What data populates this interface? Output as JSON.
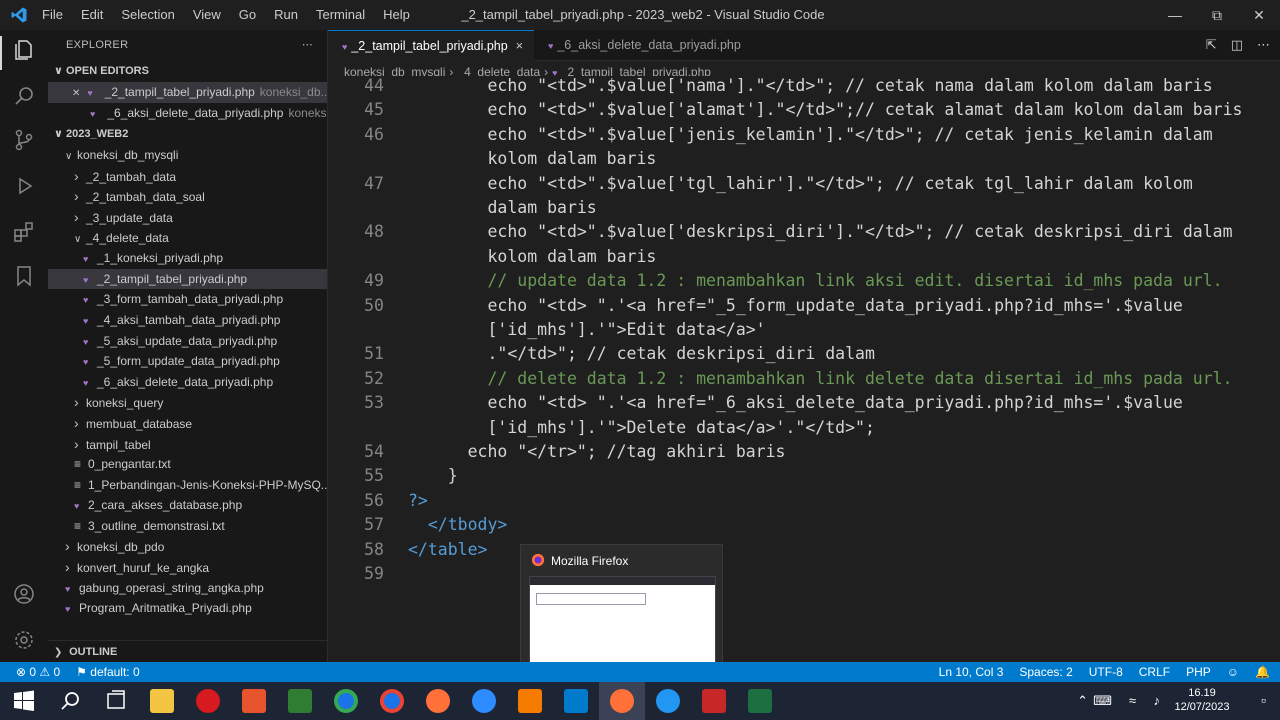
{
  "titlebar": {
    "menu": [
      "File",
      "Edit",
      "Selection",
      "View",
      "Go",
      "Run",
      "Terminal",
      "Help"
    ],
    "title": "_2_tampil_tabel_priyadi.php - 2023_web2 - Visual Studio Code"
  },
  "sidebar": {
    "header": "EXPLORER",
    "open_editors_label": "OPEN EDITORS",
    "open_editors": [
      {
        "name": "_2_tampil_tabel_priyadi.php",
        "hint": "koneksi_db..."
      },
      {
        "name": "_6_aksi_delete_data_priyadi.php",
        "hint": "koneks..."
      }
    ],
    "workspace_label": "2023_WEB2",
    "tree": [
      {
        "label": "koneksi_db_mysqli",
        "type": "folder-open"
      },
      {
        "label": "_2_tambah_data",
        "type": "folder"
      },
      {
        "label": "_2_tambah_data_soal",
        "type": "folder"
      },
      {
        "label": "_3_update_data",
        "type": "folder"
      },
      {
        "label": "_4_delete_data",
        "type": "folder-open"
      },
      {
        "label": "_1_koneksi_priyadi.php",
        "type": "php"
      },
      {
        "label": "_2_tampil_tabel_priyadi.php",
        "type": "php"
      },
      {
        "label": "_3_form_tambah_data_priyadi.php",
        "type": "php"
      },
      {
        "label": "_4_aksi_tambah_data_priyadi.php",
        "type": "php"
      },
      {
        "label": "_5_aksi_update_data_priyadi.php",
        "type": "php"
      },
      {
        "label": "_5_form_update_data_priyadi.php",
        "type": "php"
      },
      {
        "label": "_6_aksi_delete_data_priyadi.php",
        "type": "php"
      },
      {
        "label": "koneksi_query",
        "type": "folder"
      },
      {
        "label": "membuat_database",
        "type": "folder"
      },
      {
        "label": "tampil_tabel",
        "type": "folder"
      },
      {
        "label": "0_pengantar.txt",
        "type": "txt"
      },
      {
        "label": "1_Perbandingan-Jenis-Koneksi-PHP-MySQ...",
        "type": "txt"
      },
      {
        "label": "2_cara_akses_database.php",
        "type": "php"
      },
      {
        "label": "3_outline_demonstrasi.txt",
        "type": "txt"
      },
      {
        "label": "koneksi_db_pdo",
        "type": "folder"
      },
      {
        "label": "konvert_huruf_ke_angka",
        "type": "folder"
      },
      {
        "label": "gabung_operasi_string_angka.php",
        "type": "php"
      },
      {
        "label": "Program_Aritmatika_Priyadi.php",
        "type": "php"
      }
    ],
    "outline_label": "OUTLINE"
  },
  "tabs": [
    {
      "label": "_2_tampil_tabel_priyadi.php",
      "close": "×"
    },
    {
      "label": "_6_aksi_delete_data_priyadi.php"
    }
  ],
  "breadcrumb": [
    "koneksi_db_mysqli",
    "_4_delete_data",
    "_2_tampil_tabel_priyadi.php"
  ],
  "code_lines": [
    {
      "n": "44",
      "t": "        echo \"<td>\".$value['nama'].\"</td>\"; // cetak nama dalam kolom dalam baris"
    },
    {
      "n": "45",
      "t": "        echo \"<td>\".$value['alamat'].\"</td>\";// cetak alamat dalam kolom dalam baris"
    },
    {
      "n": "46",
      "t": "        echo \"<td>\".$value['jenis_kelamin'].\"</td>\"; // cetak jenis_kelamin dalam"
    },
    {
      "n": "",
      "t": "        kolom dalam baris"
    },
    {
      "n": "47",
      "t": "        echo \"<td>\".$value['tgl_lahir'].\"</td>\"; // cetak tgl_lahir dalam kolom"
    },
    {
      "n": "",
      "t": "        dalam baris"
    },
    {
      "n": "48",
      "t": "        echo \"<td>\".$value['deskripsi_diri'].\"</td>\"; // cetak deskripsi_diri dalam"
    },
    {
      "n": "",
      "t": "        kolom dalam baris"
    },
    {
      "n": "49",
      "t": "        // update data 1.2 : menambahkan link aksi edit. disertai id_mhs pada url."
    },
    {
      "n": "50",
      "t": "        echo \"<td> \".'<a href=\"_5_form_update_data_priyadi.php?id_mhs='.$value"
    },
    {
      "n": "",
      "t": "        ['id_mhs'].'\">Edit data</a>'"
    },
    {
      "n": "51",
      "t": "        .\"</td>\"; // cetak deskripsi_diri dalam"
    },
    {
      "n": "52",
      "t": "        // delete data 1.2 : menambahkan link delete data disertai id_mhs pada url."
    },
    {
      "n": "53",
      "t": "        echo \"<td> \".'<a href=\"_6_aksi_delete_data_priyadi.php?id_mhs='.$value"
    },
    {
      "n": "",
      "t": "        ['id_mhs'].'\">Delete data</a>'.\"</td>\";"
    },
    {
      "n": "54",
      "t": "      echo \"</tr>\"; //tag akhiri baris"
    },
    {
      "n": "55",
      "t": "    }"
    },
    {
      "n": "56",
      "t": "?>"
    },
    {
      "n": "57",
      "t": "  </tbody>"
    },
    {
      "n": "58",
      "t": "</table>"
    },
    {
      "n": "59",
      "t": ""
    }
  ],
  "popup": {
    "title": "Mozilla Firefox"
  },
  "statusbar": {
    "errors": "⊗ 0 ⚠ 0",
    "profile": "default: 0",
    "position": "Ln 10, Col 3",
    "spaces": "Spaces: 2",
    "encoding": "UTF-8",
    "eol": "CRLF",
    "language": "PHP"
  },
  "taskbar": {
    "time": "16.19",
    "date": "12/07/2023"
  },
  "colors": {
    "accent": "#007acc",
    "php_icon": "#a074c4"
  }
}
